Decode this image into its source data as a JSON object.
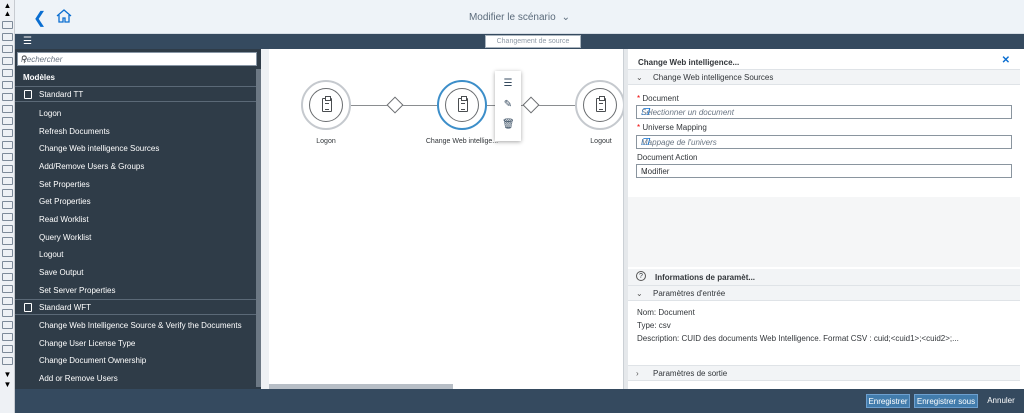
{
  "header": {
    "title": "Modifier le scénario"
  },
  "subbar": {
    "source_button": "Changement de source"
  },
  "sidebar": {
    "search_placeholder": "Rechercher",
    "models_label": "Modèles",
    "groups": [
      {
        "label": "Standard TT"
      },
      {
        "label": "Standard WFT"
      }
    ],
    "tt_items": [
      "Logon",
      "Refresh Documents",
      "Change Web intelligence Sources",
      "Add/Remove Users & Groups",
      "Set Properties",
      "Get Properties",
      "Read Worklist",
      "Query Worklist",
      "Logout",
      "Save Output",
      "Set Server Properties"
    ],
    "wft_items": [
      "Change Web Intelligence Source & Verify the Documents",
      "Change User License Type",
      "Change Document Ownership",
      "Add or Remove Users"
    ]
  },
  "canvas": {
    "nodes": [
      {
        "label": "Logon"
      },
      {
        "label": "Change Web intellige..."
      },
      {
        "label": "Logout"
      }
    ]
  },
  "panel": {
    "title": "Change Web intelligence...",
    "section_sources": "Change Web intelligence Sources",
    "document_label": "Document",
    "document_placeholder": "Sélectionner un document",
    "universe_label": "Universe Mapping",
    "universe_placeholder": "Mappage de l'univers",
    "action_label": "Document Action",
    "action_value": "Modifier",
    "info_label": "Informations de paramèt...",
    "input_section": "Paramètres d'entrée",
    "nom": "Nom: Document",
    "type": "Type: csv",
    "description": "Description: CUID des documents Web Intelligence. Format CSV : cuid;<cuid1>;<cuid2>;...",
    "output_section": "Paramètres de sortie"
  },
  "footer": {
    "save": "Enregistrer",
    "save_as": "Enregistrer sous",
    "cancel": "Annuler"
  },
  "colors": {
    "shell": "#354a5f",
    "sidebar": "#2f3c48",
    "accent": "#0a6ed1",
    "button": "#427cac"
  }
}
